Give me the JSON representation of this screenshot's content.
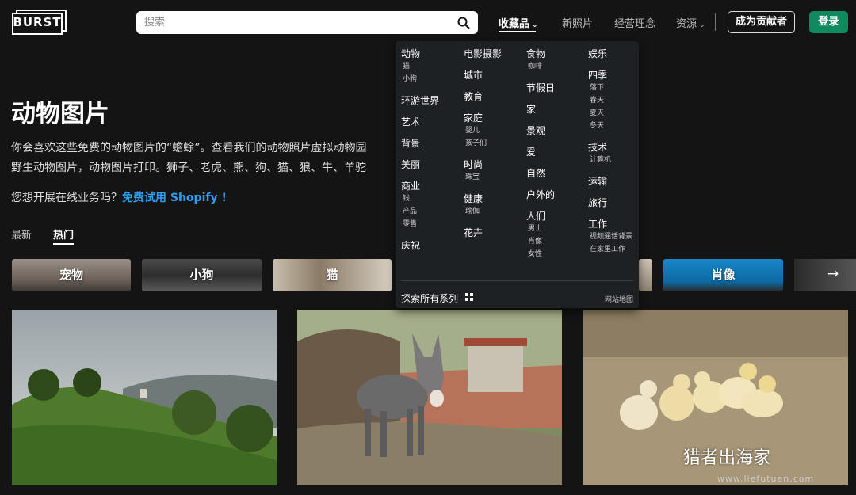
{
  "header": {
    "logo_text": "BURST",
    "search_placeholder": "搜索",
    "nav": {
      "collections": "收藏品",
      "new_photos": "新照片",
      "philosophy": "经营理念",
      "resources": "资源"
    },
    "contributor_button": "成为贡献者",
    "login_button": "登录"
  },
  "hero": {
    "title": "动物图片",
    "description_line1": "你会喜欢这些免费的动物图片的“蟾蜍”。查看我们的动物照片虚拟动物园",
    "description_line2": "野生动物图片，动物图片打印。狮子、老虎、熊、狗、猫、狼、牛、羊驼",
    "promo_text": "您想开展在线业务吗？",
    "promo_link": "免费试用 Shopify !"
  },
  "tabs": {
    "latest": "最新",
    "popular": "热门"
  },
  "chips": [
    {
      "label": "宠物"
    },
    {
      "label": "小狗"
    },
    {
      "label": "猫"
    },
    {
      "label": "肖像"
    }
  ],
  "dropdown": {
    "columns": [
      [
        {
          "label": "动物",
          "subs": [
            "猫",
            "小狗"
          ]
        },
        {
          "label": "环游世界",
          "subs": []
        },
        {
          "label": "艺术",
          "subs": []
        },
        {
          "label": "背景",
          "subs": []
        },
        {
          "label": "美丽",
          "subs": []
        },
        {
          "label": "商业",
          "subs": [
            "钱",
            "产品",
            "零售"
          ]
        },
        {
          "label": "庆祝",
          "subs": []
        }
      ],
      [
        {
          "label": "电影摄影",
          "subs": []
        },
        {
          "label": "城市",
          "subs": []
        },
        {
          "label": "教育",
          "subs": []
        },
        {
          "label": "家庭",
          "subs": [
            "婴儿",
            "孩子们"
          ]
        },
        {
          "label": "时尚",
          "subs": [
            "珠宝"
          ]
        },
        {
          "label": "健康",
          "subs": [
            "瑜伽"
          ]
        },
        {
          "label": "花卉",
          "subs": []
        }
      ],
      [
        {
          "label": "食物",
          "subs": [
            "咖啡"
          ]
        },
        {
          "label": "节假日",
          "subs": []
        },
        {
          "label": "家",
          "subs": []
        },
        {
          "label": "景观",
          "subs": []
        },
        {
          "label": "爱",
          "subs": []
        },
        {
          "label": "自然",
          "subs": []
        },
        {
          "label": "户外的",
          "subs": []
        },
        {
          "label": "人们",
          "subs": [
            "男士",
            "肖像",
            "女性"
          ]
        }
      ],
      [
        {
          "label": "娱乐",
          "subs": []
        },
        {
          "label": "四季",
          "subs": [
            "落下",
            "春天",
            "夏天",
            "冬天"
          ]
        },
        {
          "label": "技术",
          "subs": [
            "计算机"
          ]
        },
        {
          "label": "运输",
          "subs": []
        },
        {
          "label": "旅行",
          "subs": []
        },
        {
          "label": "工作",
          "subs": [
            "视频通话背景",
            "在家里工作"
          ]
        }
      ]
    ],
    "explore_all": "探索所有系列",
    "sitemap": "网站地图"
  },
  "watermark": {
    "text": "猎者出海家",
    "url": "www.liefutuan.com"
  },
  "colors": {
    "accent_green": "#0f8a5f",
    "link_blue": "#2ea0f0",
    "background": "#141414",
    "dropdown_bg": "#1e2124"
  }
}
